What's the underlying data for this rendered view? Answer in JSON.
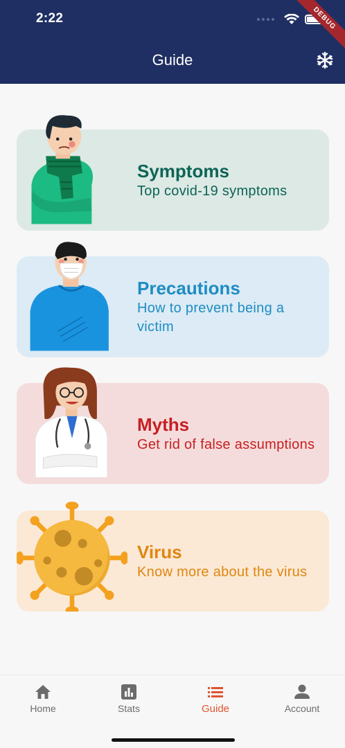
{
  "status_bar": {
    "time": "2:22",
    "debug_label": "DEBUG"
  },
  "header": {
    "title": "Guide",
    "action_icon": "snowflake-icon"
  },
  "cards": [
    {
      "title": "Symptoms",
      "subtitle": "Top covid-19 symptoms",
      "bg": "#dde9e4",
      "color": "#0c6457"
    },
    {
      "title": "Precautions",
      "subtitle": "How to prevent being a victim",
      "bg": "#dcebf5",
      "color": "#1f8cc3"
    },
    {
      "title": "Myths",
      "subtitle": "Get rid of false assumptions",
      "bg": "#f5dcdc",
      "color": "#c61f22"
    },
    {
      "title": "Virus",
      "subtitle": "Know more about the virus",
      "bg": "#fbe9d6",
      "color": "#e0860f"
    }
  ],
  "nav": {
    "items": [
      {
        "label": "Home",
        "icon": "home-icon"
      },
      {
        "label": "Stats",
        "icon": "stats-icon"
      },
      {
        "label": "Guide",
        "icon": "list-icon"
      },
      {
        "label": "Account",
        "icon": "person-icon"
      }
    ],
    "active_color": "#e0532f",
    "inactive_color": "#6b6b6b"
  }
}
